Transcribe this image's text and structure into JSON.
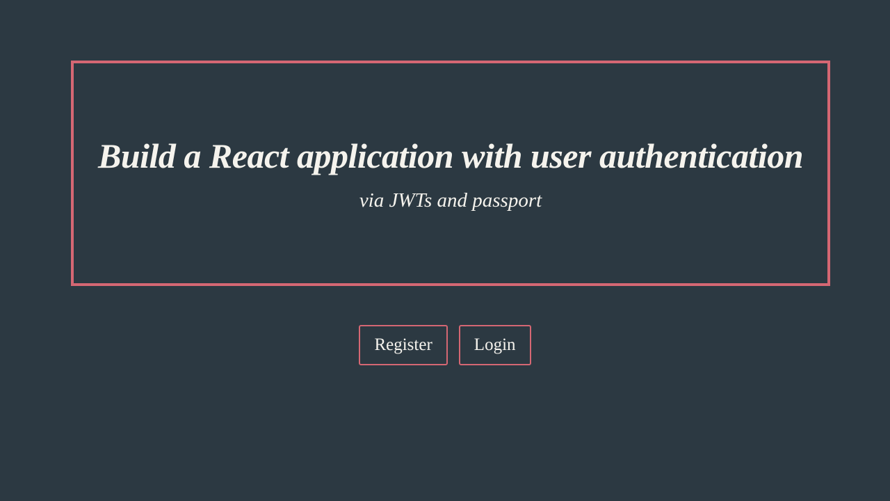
{
  "hero": {
    "title": "Build a React application with user authentication",
    "subtitle": "via JWTs and passport"
  },
  "buttons": {
    "register": "Register",
    "login": "Login"
  },
  "colors": {
    "background": "#2c3942",
    "accent": "#d56773",
    "text": "#f5f3ed"
  }
}
